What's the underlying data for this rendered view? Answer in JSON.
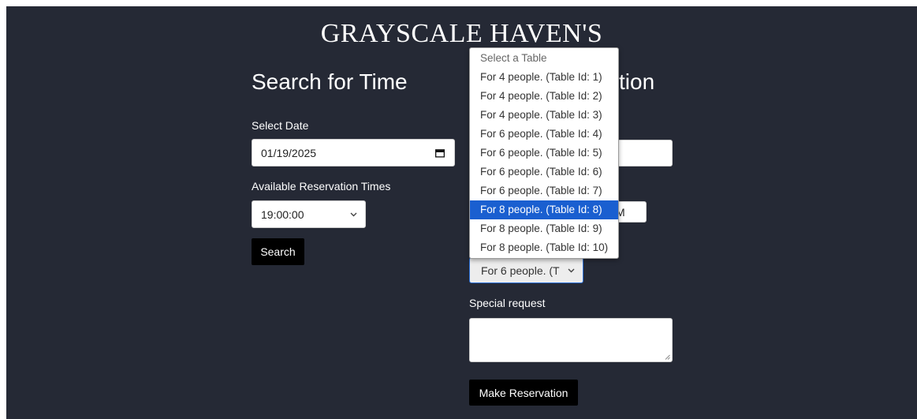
{
  "site": {
    "title": "GRAYSCALE HAVEN'S"
  },
  "search": {
    "heading": "Search for Time",
    "date_label": "Select Date",
    "date_value": "01/19/2025",
    "times_label": "Available Reservation Times",
    "time_value": "19:00:00",
    "button_label": "Search"
  },
  "reservation": {
    "heading_visible_part": "tion",
    "time_field_partial": "M",
    "table_select_value": "For 6 people. (T",
    "special_request_label": "Special request",
    "special_request_value": "",
    "button_label": "Make Reservation"
  },
  "table_dropdown": {
    "options": [
      "Select a Table",
      "For 4 people. (Table Id: 1)",
      "For 4 people. (Table Id: 2)",
      "For 4 people. (Table Id: 3)",
      "For 6 people. (Table Id: 4)",
      "For 6 people. (Table Id: 5)",
      "For 6 people. (Table Id: 6)",
      "For 6 people. (Table Id: 7)",
      "For 8 people. (Table Id: 8)",
      "For 8 people. (Table Id: 9)",
      "For 8 people. (Table Id: 10)"
    ],
    "highlighted_option": "For 8 people. (Table Id: 8)"
  },
  "colors": {
    "background": "#252935",
    "highlight": "#1a5fd0",
    "button": "#000000"
  },
  "icons": {
    "date": "calendar-icon",
    "select": "chevron-down-icon",
    "textarea": "resize-grip-icon"
  }
}
